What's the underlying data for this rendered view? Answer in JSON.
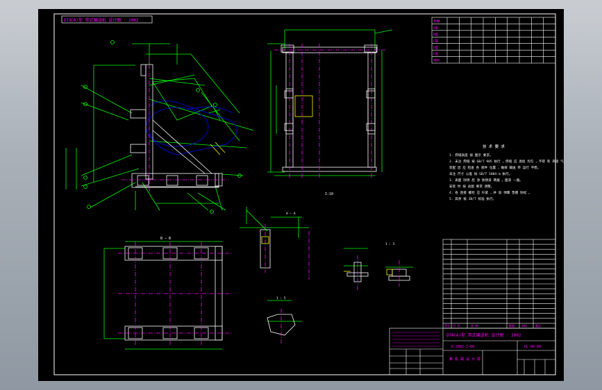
{
  "viewer": {
    "background": "#a9b0b8"
  },
  "sheet": {
    "background": "#000000",
    "border_color": "#ffffff"
  },
  "colors": {
    "outline": "#ffffff",
    "dimension": "#00ff00",
    "center_line": "#ff00ff",
    "hidden": "#0000ff",
    "text": "#ff00ff",
    "accent": "#ffff00"
  },
  "labels": {
    "top_left_title": "DTⅡ(A)型 带式输送机 设计图 · 2002",
    "section_bb": "B — B",
    "view_mark_1": "I:10",
    "scale_1_5": "1 : 5",
    "scale_1_5b": "1 : 5",
    "view_a": "A — A",
    "notes_header": "技 术 要 求",
    "title_name": "DTⅡ(A)型 带式输送机 设计图 · 2002",
    "drawing_number": "D-2002-1-00",
    "part_number": "DL-00-00",
    "company": "某 机 械 设 计 院"
  },
  "tech_notes": [
    "1. 焊缝高度 按 图示 要求。",
    "2. 未注 焊缝 按 GB/T 985 执行 ，焊缝 应 连续 均匀 ，不得 有 夹渣 气孔。",
    "   装配 后 应 检查 各 部件 位置 ，确保 输送 带 运行 平稳。",
    "   未注 尺寸 公差 按 GB/T 1804-m 执行。",
    "3. 表面 除锈 后 涂 防锈漆 两遍 ，面漆 一遍。",
    "   安装 时 按 总图 要求 调整。",
    "4. 各 连接 螺栓 应 拧紧 ，并 加 弹簧 垫圈 防松 。",
    "5. 其余 按 JB/T 标准 执行。"
  ],
  "top_table": {
    "row_labels": [
      "参数",
      "A型",
      "B型",
      "C型",
      "D型",
      "E型",
      "材料"
    ],
    "cols": 9
  },
  "parts_list": {
    "rows": 17,
    "header": [
      "序号",
      "代 号",
      "名 称",
      "数量",
      "材料",
      "备注"
    ]
  }
}
